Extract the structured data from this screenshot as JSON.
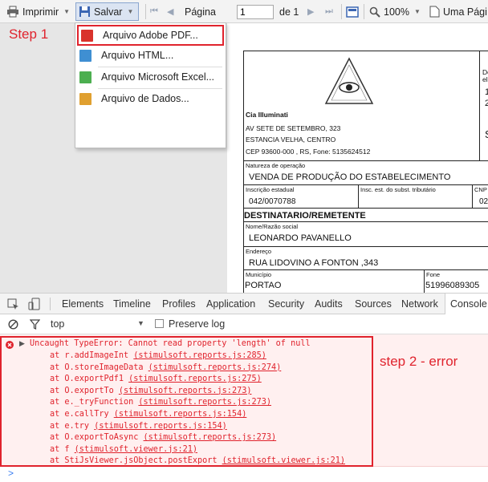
{
  "toolbar": {
    "print_label": "Imprimir",
    "save_label": "Salvar",
    "page_label": "Página",
    "page_value": "1",
    "page_of": "de 1",
    "zoom_label": "100%",
    "find_label": "Uma Pági"
  },
  "save_menu": {
    "items": [
      {
        "label": "Arquivo Adobe PDF...",
        "icon": "pdf-file-icon",
        "color": "#d9332c"
      },
      {
        "label": "Arquivo HTML...",
        "icon": "html-file-icon",
        "color": "#3f8fd2"
      },
      {
        "label": "Arquivo Microsoft Excel...",
        "icon": "excel-file-icon",
        "color": "#4caf50"
      },
      {
        "label": "Arquivo de Dados...",
        "icon": "data-file-icon",
        "color": "#e0a030"
      }
    ]
  },
  "annotations": {
    "step1": "Step 1",
    "step2": "step 2 - error",
    "color": "#e0232d"
  },
  "document": {
    "company": "Cia Illuminati",
    "address1": "AV SETE DE SETEMBRO, 323",
    "address2": "ESTANCIA VELHA, CENTRO",
    "address3": "CEP   93600-000 , RS, Fone: 5135624512",
    "right_top1": "Do",
    "right_top2": "ele",
    "right_digit1": "1",
    "right_digit2": "2",
    "right_s": "S",
    "natureza_label": "Natureza de operação",
    "natureza_value": "VENDA DE PRODUÇÃO DO ESTABELECIMENTO",
    "inscricao_label": "Inscrição estadual",
    "inscricao_value": "042/0070788",
    "subst_label": "Insc. est. do subst. tributário",
    "cnp_label": "CNP",
    "cnp_value": "02",
    "section_title": "DESTINATARIO/REMETENTE",
    "nome_label": "Nome/Razão social",
    "nome_value": "LEONARDO PAVANELLO",
    "endereco_label": "Endereço",
    "endereco_value": "RUA LIDOVINO A FONTON ,343",
    "municipio_label": "Município",
    "municipio_value": "PORTAO",
    "fone_label": "Fone",
    "fone_value": "51996089305"
  },
  "devtools": {
    "tabs": [
      "Elements",
      "Timeline",
      "Profiles",
      "Application",
      "Security",
      "Audits",
      "Sources",
      "Network",
      "Console"
    ],
    "active_tab": "Console",
    "context": "top",
    "preserve_log": "Preserve log",
    "error_message": "Uncaught TypeError: Cannot read property 'length' of null",
    "stack": [
      {
        "fn": "at r.addImageInt ",
        "src": "(stimulsoft.reports.js:285)"
      },
      {
        "fn": "at O.storeImageData ",
        "src": "(stimulsoft.reports.js:274)"
      },
      {
        "fn": "at O.exportPdf1 ",
        "src": "(stimulsoft.reports.js:275)"
      },
      {
        "fn": "at O.exportTo ",
        "src": "(stimulsoft.reports.js:273)"
      },
      {
        "fn": "at e._tryFunction ",
        "src": "(stimulsoft.reports.js:273)"
      },
      {
        "fn": "at e.callTry ",
        "src": "(stimulsoft.reports.js:154)"
      },
      {
        "fn": "at e.try ",
        "src": "(stimulsoft.reports.js:154)"
      },
      {
        "fn": "at O.exportToAsync ",
        "src": "(stimulsoft.reports.js:273)"
      },
      {
        "fn": "at f ",
        "src": "(stimulsoft.viewer.js:21)"
      },
      {
        "fn": "at StiJsViewer.jsObject.postExport ",
        "src": "(stimulsoft.viewer.js:21)"
      }
    ],
    "prompt": ">"
  }
}
